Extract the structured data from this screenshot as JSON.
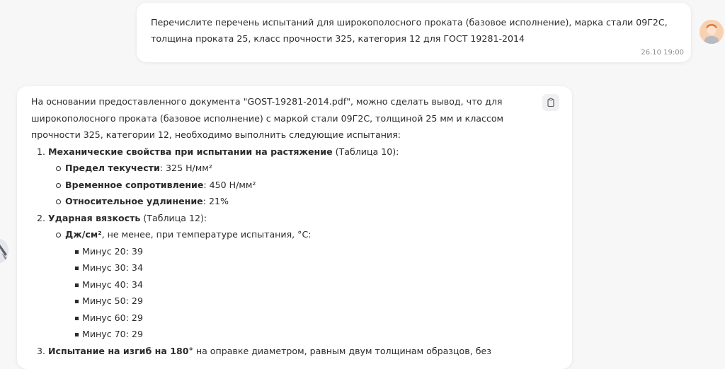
{
  "user_message": {
    "text": "Перечислите перечень испытаний для широкополосного проката (базовое исполнение), марка стали 09Г2С, толщина проката 25, класс прочности 325, категория 12 для ГОСТ 19281-2014",
    "time": "26.10 19:00"
  },
  "bot_message": {
    "intro": "На основании предоставленного документа \"GOST-19281-2014.pdf\", можно сделать вывод, что для широкополосного проката (базовое исполнение) с маркой стали 09Г2С, толщиной 25 мм и классом прочности 325, категории 12, необходимо выполнить следующие испытания:",
    "items": [
      {
        "num": "1.",
        "title": "Механические свойства при испытании на растяжение",
        "note": " (Таблица 10):",
        "subitems": [
          {
            "label": "Предел текучести",
            "value": ": 325 Н/мм²"
          },
          {
            "label": "Временное сопротивление",
            "value": ": 450 Н/мм²"
          },
          {
            "label": "Относительное удлинение",
            "value": ": 21%"
          }
        ]
      },
      {
        "num": "2.",
        "title": "Ударная вязкость",
        "note": " (Таблица 12):",
        "subitems": [
          {
            "label": "Дж/см²",
            "value": ", не менее, при температуре испытания, °С:"
          }
        ],
        "values": [
          "Минус 20: 39",
          "Минус 30: 34",
          "Минус 40: 34",
          "Минус 50: 29",
          "Минус 60: 29",
          "Минус 70: 29"
        ]
      },
      {
        "num": "3.",
        "title": "Испытание на изгиб на 180°",
        "note": " на оправке диаметром, равным двум толщинам образцов, без"
      }
    ]
  },
  "icons": {
    "copy": "clipboard-icon",
    "user_avatar": "user-avatar-icon",
    "bot_avatar": "bot-avatar-icon"
  }
}
